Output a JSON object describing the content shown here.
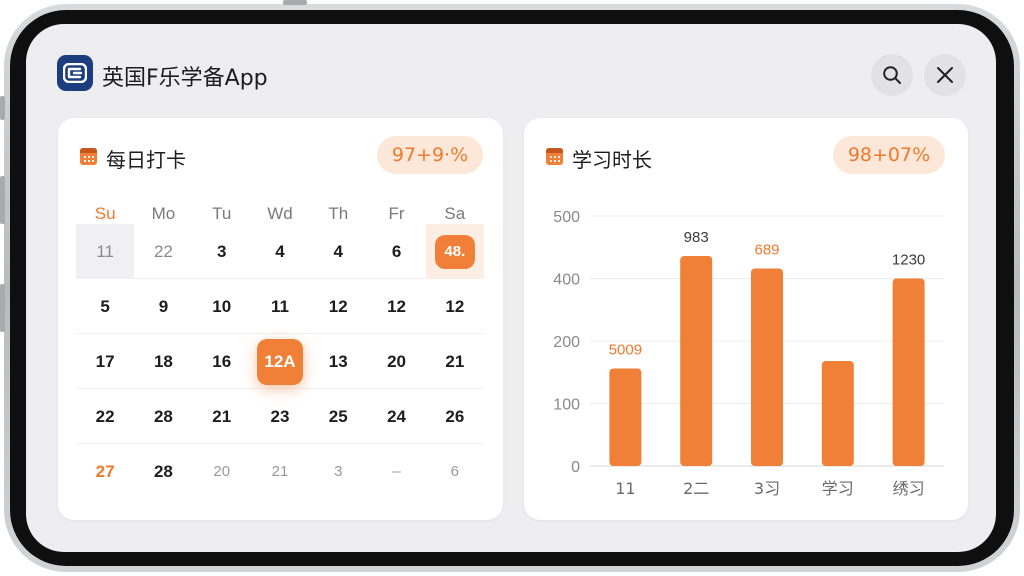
{
  "app": {
    "title": "英国F乐学备App",
    "logo_icon": "app-logo-icon",
    "brand_color": "#1d3e7e",
    "accent_color": "#f07f37"
  },
  "header": {
    "search_icon": "search-icon",
    "close_icon": "close-icon"
  },
  "checkin_card": {
    "title": "每日打卡",
    "badge": "97+9·%",
    "weekdays": [
      "Su",
      "Mo",
      "Tu",
      "Wd",
      "Th",
      "Fr",
      "Sa"
    ],
    "weeks": [
      [
        "11",
        "22",
        "3",
        "4",
        "4",
        "6",
        "48."
      ],
      [
        "5",
        "9",
        "10",
        "11",
        "12",
        "12",
        "12"
      ],
      [
        "17",
        "18",
        "16",
        "12A",
        "13",
        "20",
        "21"
      ],
      [
        "22",
        "28",
        "21",
        "23",
        "25",
        "24",
        "26"
      ],
      [
        "27",
        "28",
        "20",
        "21",
        "3",
        "–",
        "6"
      ]
    ]
  },
  "study_card": {
    "title": "学习时长",
    "badge": "98+07%"
  },
  "chart_data": {
    "type": "bar",
    "categories": [
      "11",
      "2二",
      "3习",
      "学习",
      "绣习"
    ],
    "values": [
      195,
      420,
      395,
      210,
      375
    ],
    "data_labels": [
      "5009",
      "983",
      "689",
      "",
      "1230"
    ],
    "ytick_labels": [
      "0",
      "100",
      "200",
      "400",
      "500"
    ],
    "ylim": [
      0,
      500
    ],
    "grid": true,
    "bar_color": "#f07f37"
  }
}
